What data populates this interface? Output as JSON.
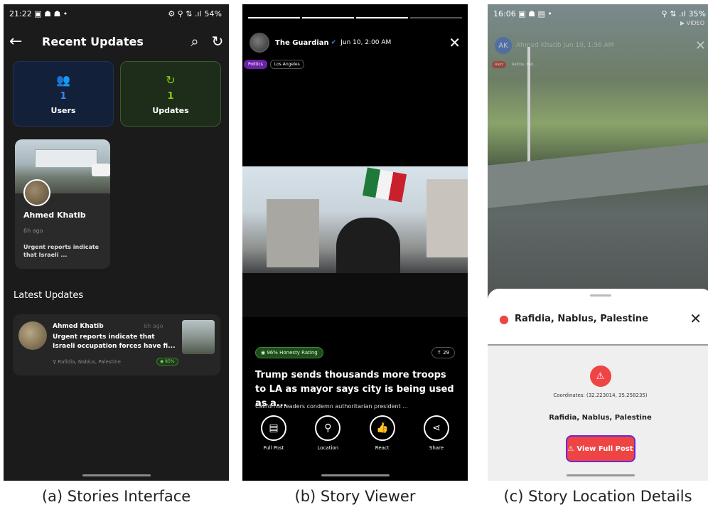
{
  "panel_a": {
    "status": {
      "time": "21:22",
      "left_icons": "▣ ☗ ☗ •",
      "right_icons": "⚙ ⚲ ⇅ .ıl",
      "battery": "54%"
    },
    "header": {
      "title": "Recent Updates"
    },
    "stats": [
      {
        "value": "1",
        "label": "Users",
        "color": "#3b82f6"
      },
      {
        "value": "1",
        "label": "Updates",
        "color": "#84cc16"
      }
    ],
    "card": {
      "name": "Ahmed Khatib",
      "time": "6h ago",
      "snippet": "Urgent reports indicate that Israeli ..."
    },
    "section_title": "Latest Updates",
    "latest": {
      "name": "Ahmed Khatib",
      "time": "6h ago",
      "text": "Urgent reports indicate that Israeli occupation forces have fi...",
      "location": "Rafidia, Nablus, Palestine",
      "badge": "85%"
    },
    "caption": "(a) Stories Interface"
  },
  "panel_b": {
    "source": {
      "name": "The Guardian",
      "date": "Jun 10, 2:00 AM"
    },
    "tags": [
      "Politics",
      "Los Angeles"
    ],
    "rating": "96% Honesty Rating",
    "votes": "29",
    "headline": "Trump sends thousands more troops to LA as mayor says city is being used as a...",
    "sub": "California leaders condemn authoritarian president ...",
    "actions": [
      "Full Post",
      "Location",
      "React",
      "Share"
    ],
    "caption": "(b) Story Viewer"
  },
  "panel_c": {
    "status": {
      "time": "16:06",
      "left_icons": "▣ ☗ ▤ •",
      "right_icons": "⚲ ⇅ .ıl",
      "battery": "35%"
    },
    "video_label": "VIDEO",
    "source": {
      "initials": "AK",
      "text": "Ahmed Khatib  Jun 10, 1:56 AM"
    },
    "tags": [
      "Alert",
      "Rafidia, Nab..."
    ],
    "place": "Rafidia, Nablus, Palestine",
    "coordinates": "Coordinates: (32.223014, 35.258235)",
    "location": "Rafidia, Nablus, Palestine",
    "button": "View Full Post",
    "caption": "(c) Story Location Details"
  }
}
